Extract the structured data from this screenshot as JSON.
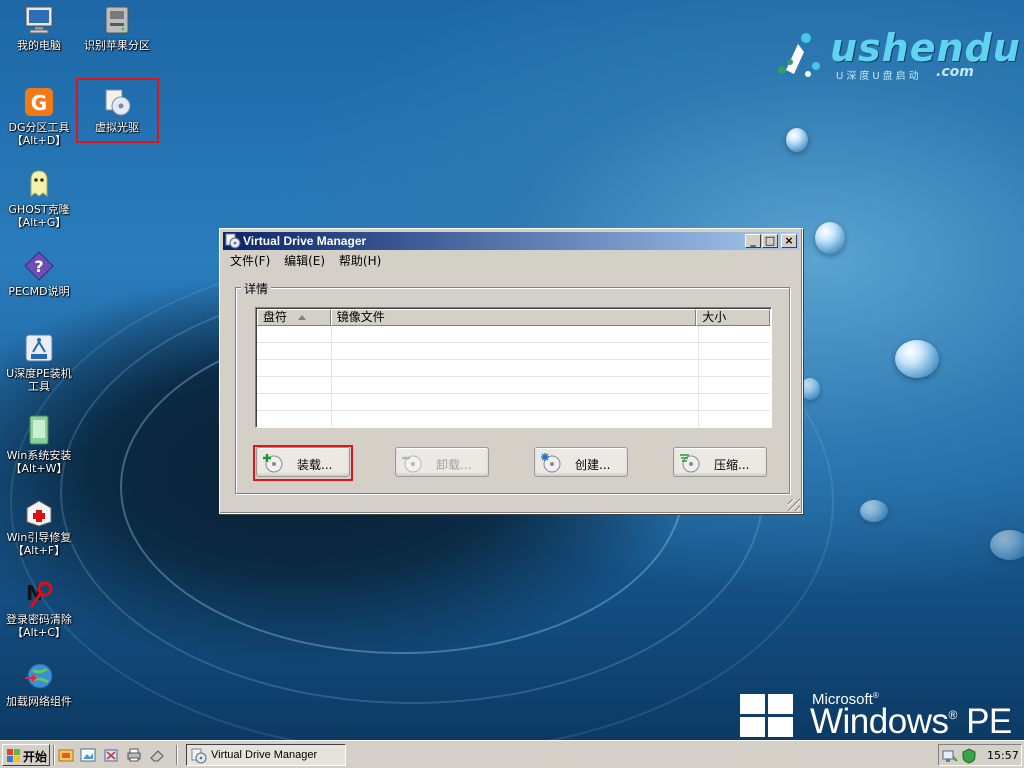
{
  "brand": {
    "name": "ushendu",
    "subtitle": "U深度U盘启动",
    "domain": ".com"
  },
  "os_logo": {
    "vendor": "Microsoft",
    "product": "Windows",
    "edition": "PE"
  },
  "desktop_icons": [
    {
      "label": "我的电脑",
      "icon": "computer-icon"
    },
    {
      "label": "识别苹果分区",
      "icon": "disk-drive-icon"
    },
    {
      "label": "DG分区工具\n【Alt+D】",
      "icon": "partition-tool-icon"
    },
    {
      "label": "虚拟光驱",
      "icon": "virtual-drive-icon"
    },
    {
      "label": "GHOST克隆\n【Alt+G】",
      "icon": "ghost-icon"
    },
    {
      "label": "PECMD说明",
      "icon": "help-icon"
    },
    {
      "label": "U深度PE装机\n工具",
      "icon": "installer-icon"
    },
    {
      "label": "Win系统安装\n【Alt+W】",
      "icon": "system-install-icon"
    },
    {
      "label": "Win引导修复\n【Alt+F】",
      "icon": "boot-repair-icon"
    },
    {
      "label": "登录密码清除\n【Alt+C】",
      "icon": "password-clear-icon"
    },
    {
      "label": "加载网络组件",
      "icon": "network-icon"
    }
  ],
  "window": {
    "title": "Virtual Drive Manager",
    "controls": {
      "minimize": "_",
      "maximize": "□",
      "close": "×"
    },
    "menu": [
      "文件(F)",
      "编辑(E)",
      "帮助(H)"
    ],
    "group_title": "详情",
    "columns": [
      "盘符",
      "镜像文件",
      "大小"
    ],
    "rows": [],
    "buttons": [
      {
        "label": "装载...",
        "enabled": true,
        "icon": "mount-disc-icon"
      },
      {
        "label": "卸载...",
        "enabled": false,
        "icon": "unmount-disc-icon"
      },
      {
        "label": "创建...",
        "enabled": true,
        "icon": "create-disc-icon"
      },
      {
        "label": "压缩...",
        "enabled": true,
        "icon": "compress-disc-icon"
      }
    ]
  },
  "taskbar": {
    "start_label": "开始",
    "quick_launch": [
      "explorer-icon",
      "image-viewer-icon",
      "tools-icon",
      "printer-icon",
      "eraser-icon"
    ],
    "tasks": [
      {
        "label": "Virtual Drive Manager",
        "icon": "virtual-drive-icon"
      }
    ],
    "tray_icons": [
      "network-status-icon",
      "security-icon"
    ],
    "clock": "15:57"
  },
  "colors": {
    "highlight": "#e0141e",
    "titlebar_start": "#0a246a",
    "titlebar_end": "#a6caf0",
    "dialog_face": "#d4d0c8"
  }
}
